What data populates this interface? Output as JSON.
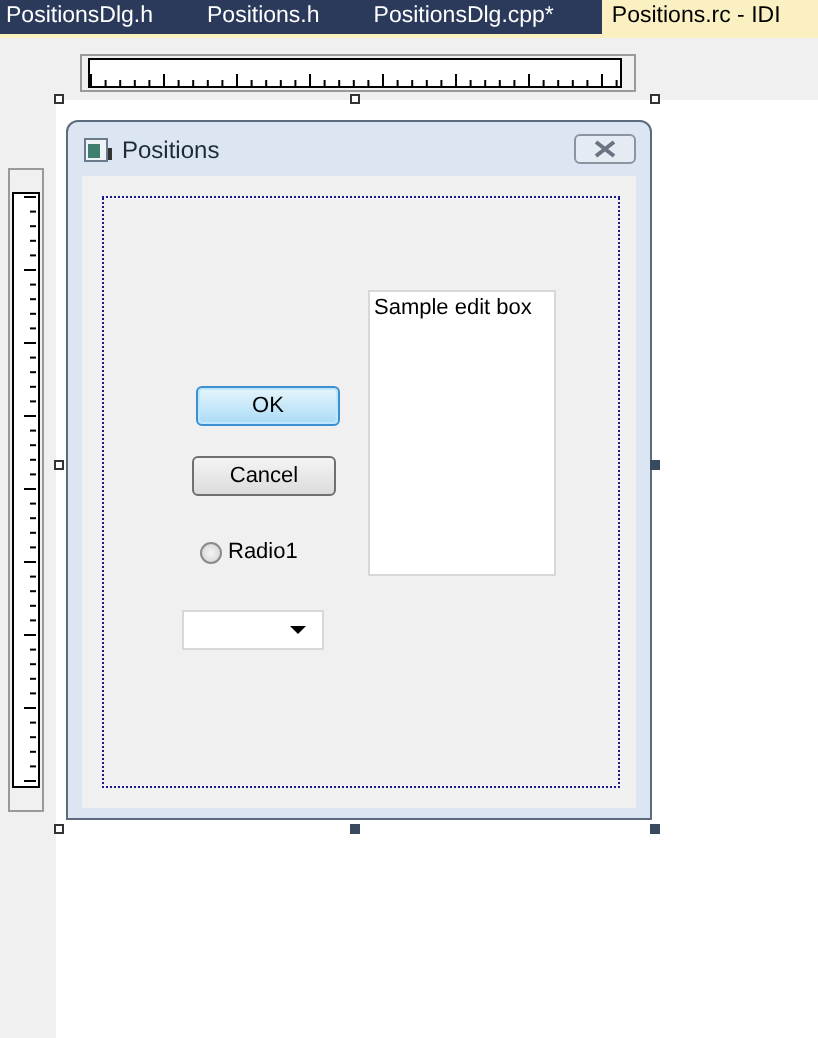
{
  "tabs": [
    {
      "label": "PositionsDlg.h",
      "selected": false
    },
    {
      "label": "Positions.h",
      "selected": false
    },
    {
      "label": "PositionsDlg.cpp*",
      "selected": false
    },
    {
      "label": "Positions.rc - IDI",
      "selected": true
    }
  ],
  "dialog": {
    "title": "Positions",
    "controls": [
      {
        "kind": "edit",
        "text": "Sample edit box"
      },
      {
        "kind": "button",
        "label": "OK",
        "default": true
      },
      {
        "kind": "button",
        "label": "Cancel",
        "default": false
      },
      {
        "kind": "radio",
        "label": "Radio1",
        "checked": false
      },
      {
        "kind": "combo"
      }
    ]
  }
}
